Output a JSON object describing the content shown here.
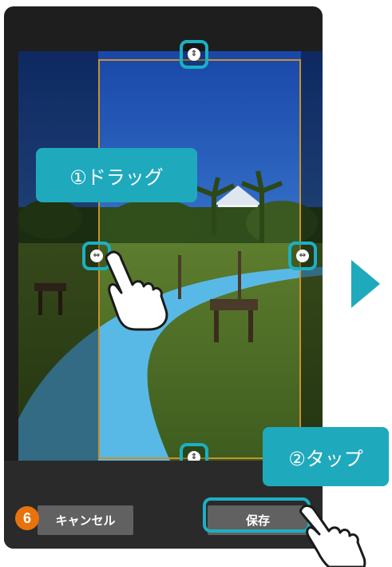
{
  "callouts": {
    "drag": "①ドラッグ",
    "tap": "②タップ"
  },
  "buttons": {
    "cancel": "キャンセル",
    "save": "保存"
  },
  "step_number": "6",
  "handles": {
    "top": "⇕",
    "bottom": "⇕",
    "left": "⇔",
    "right": "⇔"
  },
  "colors": {
    "accent": "#1fa9bd",
    "crop_border": "#c8912b",
    "step_badge": "#e8730c",
    "button": "#616161"
  }
}
